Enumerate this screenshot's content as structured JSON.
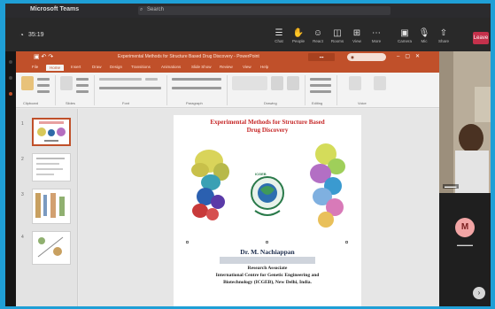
{
  "teams": {
    "app_name": "Microsoft Teams",
    "search_placeholder": "Search",
    "timer": "35:19",
    "toolbar": [
      {
        "glyph": "☰",
        "label": "Chat"
      },
      {
        "glyph": "✋",
        "label": "People"
      },
      {
        "glyph": "☺",
        "label": "React"
      },
      {
        "glyph": "◫",
        "label": "Rooms"
      },
      {
        "glyph": "⊞",
        "label": "View"
      },
      {
        "glyph": "⋯",
        "label": "More"
      },
      {
        "glyph": "▣",
        "label": "Camera"
      },
      {
        "glyph": "🎙",
        "label": "Mic"
      },
      {
        "glyph": "⇧",
        "label": "Share"
      }
    ],
    "leave_label": "Leave"
  },
  "powerpoint": {
    "window_title": "Experimental Methods for Structure Based Drug Discovery - PowerPoint",
    "tabs": [
      "File",
      "Home",
      "Insert",
      "Draw",
      "Design",
      "Transitions",
      "Animations",
      "Slide Show",
      "Review",
      "View",
      "Help"
    ],
    "ribbon_groups": [
      "Clipboard",
      "Slides",
      "Font",
      "Paragraph",
      "Drawing",
      "Editing",
      "Voice"
    ],
    "thumbnail_numbers": [
      "1",
      "2",
      "3",
      "4"
    ]
  },
  "slide": {
    "title_line1": "Experimental Methods for Structure Based",
    "title_line2": "Drug Discovery",
    "logo_text": "ICGEB",
    "author": "Dr. M. Nachiappan",
    "role": "Research Associate",
    "org_line1": "International Centre for Genetic Engineering and",
    "org_line2": "Biotechnology (ICGEB), New Delhi, India."
  },
  "participants": {
    "avatar_initial": "M",
    "colors": {
      "accent": "#c0502a",
      "title_red": "#c62828",
      "leave_red": "#c4314b",
      "border_blue": "#1f9fd6"
    }
  }
}
